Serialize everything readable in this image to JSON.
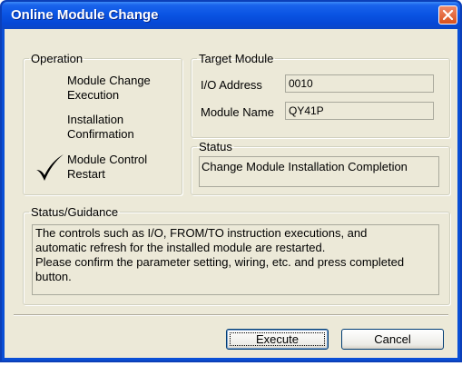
{
  "window": {
    "title": "Online Module Change"
  },
  "operation": {
    "legend": "Operation",
    "steps": [
      {
        "label_line1": "Module Change",
        "label_line2": "Execution",
        "checked": false
      },
      {
        "label_line1": "Installation",
        "label_line2": "Confirmation",
        "checked": false
      },
      {
        "label_line1": "Module Control",
        "label_line2": "Restart",
        "checked": true
      }
    ]
  },
  "target_module": {
    "legend": "Target Module",
    "io_address_label": "I/O Address",
    "io_address_value": "0010",
    "module_name_label": "Module Name",
    "module_name_value": "QY41P"
  },
  "status": {
    "legend": "Status",
    "text": "Change Module Installation Completion"
  },
  "guidance": {
    "legend": "Status/Guidance",
    "lines": [
      "The controls such as I/O, FROM/TO instruction executions, and",
      "automatic refresh for the installed module are restarted.",
      "Please confirm the parameter setting, wiring, etc. and press completed",
      "button."
    ]
  },
  "buttons": {
    "execute": "Execute",
    "cancel": "Cancel"
  },
  "colors": {
    "titlebar": "#0a54e3",
    "dialog_bg": "#ece9d8",
    "close": "#d9501c"
  },
  "icons": {
    "close": "close-icon",
    "check": "checkmark-icon"
  }
}
